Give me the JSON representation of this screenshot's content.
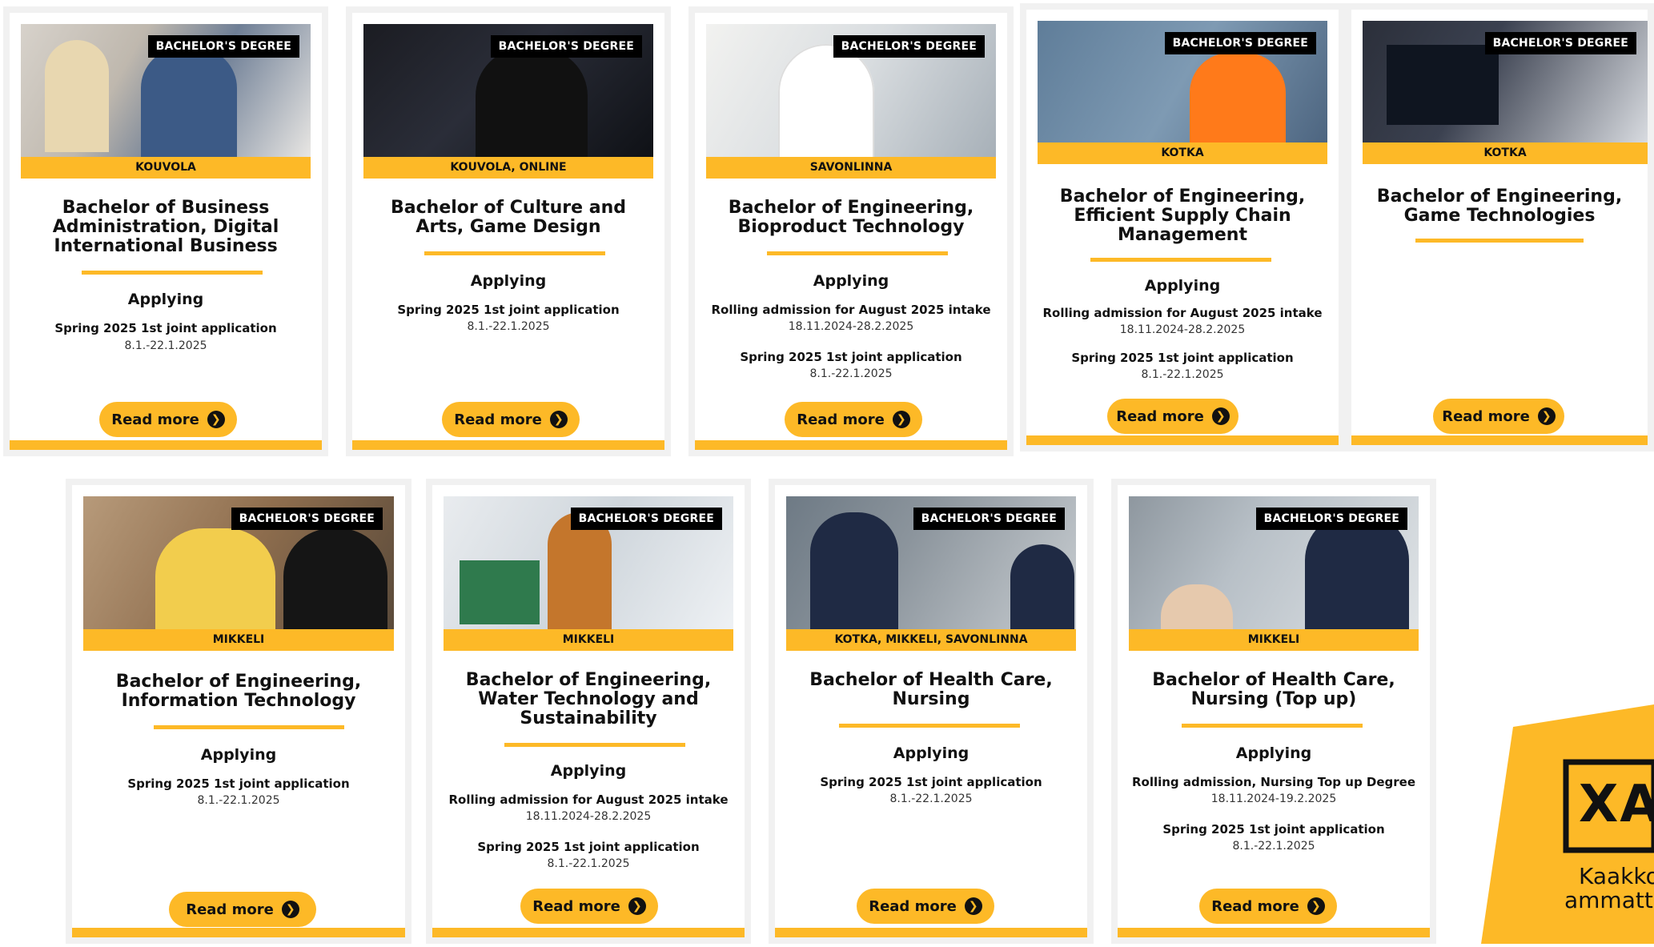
{
  "badge": "BACHELOR'S DEGREE",
  "read_more": "Read more",
  "applying": "Applying",
  "cards": [
    {
      "location": "KOUVOLA",
      "title": "Bachelor of Business Administration, Digital International Business",
      "applications": [
        {
          "label": "Spring 2025 1st joint application",
          "date": "8.1.-22.1.2025"
        }
      ]
    },
    {
      "location": "KOUVOLA, ONLINE",
      "title": "Bachelor of Culture and Arts, Game Design",
      "applications": [
        {
          "label": "Spring 2025 1st joint application",
          "date": "8.1.-22.1.2025"
        }
      ]
    },
    {
      "location": "SAVONLINNA",
      "title": "Bachelor of Engineering, Bioproduct Technology",
      "applications": [
        {
          "label": "Rolling admission for August 2025 intake",
          "date": "18.11.2024-28.2.2025"
        },
        {
          "label": "Spring 2025 1st joint application",
          "date": "8.1.-22.1.2025"
        }
      ]
    },
    {
      "location": "KOTKA",
      "title": "Bachelor of Engineering, Efficient Supply Chain Management",
      "applications": [
        {
          "label": "Rolling admission for August 2025 intake",
          "date": "18.11.2024-28.2.2025"
        },
        {
          "label": "Spring 2025 1st joint application",
          "date": "8.1.-22.1.2025"
        }
      ]
    },
    {
      "location": "KOTKA",
      "title": "Bachelor of Engineering, Game Technologies",
      "applications": []
    },
    {
      "location": "MIKKELI",
      "title": "Bachelor of Engineering, Information Technology",
      "applications": [
        {
          "label": "Spring 2025 1st joint application",
          "date": "8.1.-22.1.2025"
        }
      ]
    },
    {
      "location": "MIKKELI",
      "title": "Bachelor of Engineering, Water Technology and Sustainability",
      "applications": [
        {
          "label": "Rolling admission for August 2025 intake",
          "date": "18.11.2024-28.2.2025"
        },
        {
          "label": "Spring 2025 1st joint application",
          "date": "8.1.-22.1.2025"
        }
      ]
    },
    {
      "location": "KOTKA, MIKKELI, SAVONLINNA",
      "title": "Bachelor of Health Care, Nursing",
      "applications": [
        {
          "label": "Spring 2025 1st joint application",
          "date": "8.1.-22.1.2025"
        }
      ]
    },
    {
      "location": "MIKKELI",
      "title": "Bachelor of Health Care, Nursing (Top up)",
      "applications": [
        {
          "label": "Rolling admission, Nursing Top up Degree",
          "date": "18.11.2024-19.2.2025"
        },
        {
          "label": "Spring 2025 1st joint application",
          "date": "8.1.-22.1.2025"
        }
      ]
    }
  ],
  "logo": {
    "mark": "XA",
    "line1": "Kaakko",
    "line2": "ammatt"
  },
  "colors": {
    "accent": "#fdb927",
    "badge_bg": "#000000",
    "card_border": "#f1f1f1"
  }
}
